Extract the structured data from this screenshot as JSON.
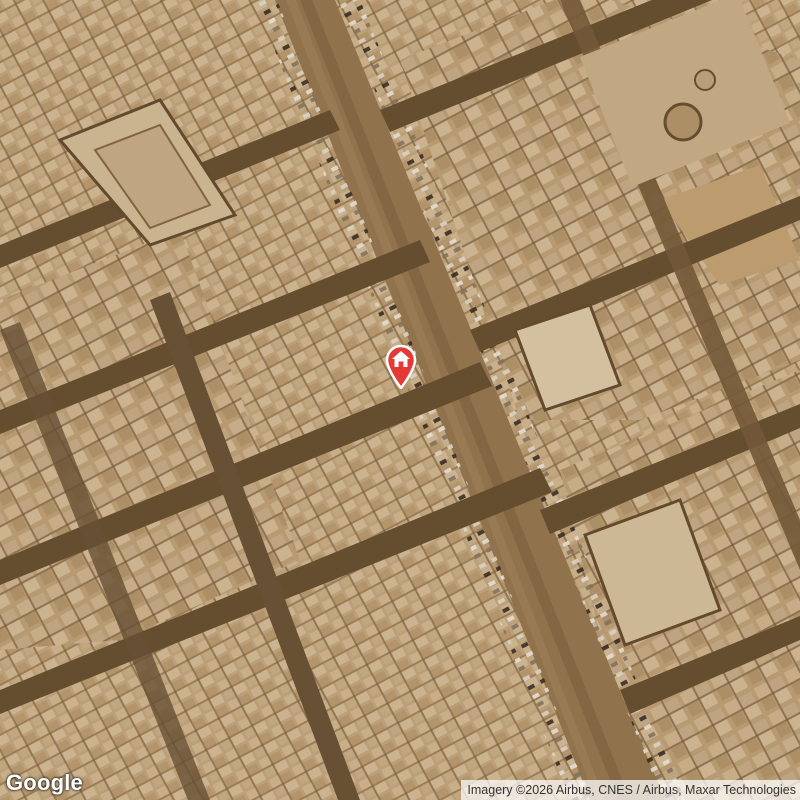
{
  "map": {
    "view": "satellite",
    "marker": {
      "icon": "home-icon",
      "color": "#e53935"
    },
    "logo": "Google",
    "attribution": "Imagery ©2026 Airbus, CNES / Airbus, Maxar Technologies"
  }
}
